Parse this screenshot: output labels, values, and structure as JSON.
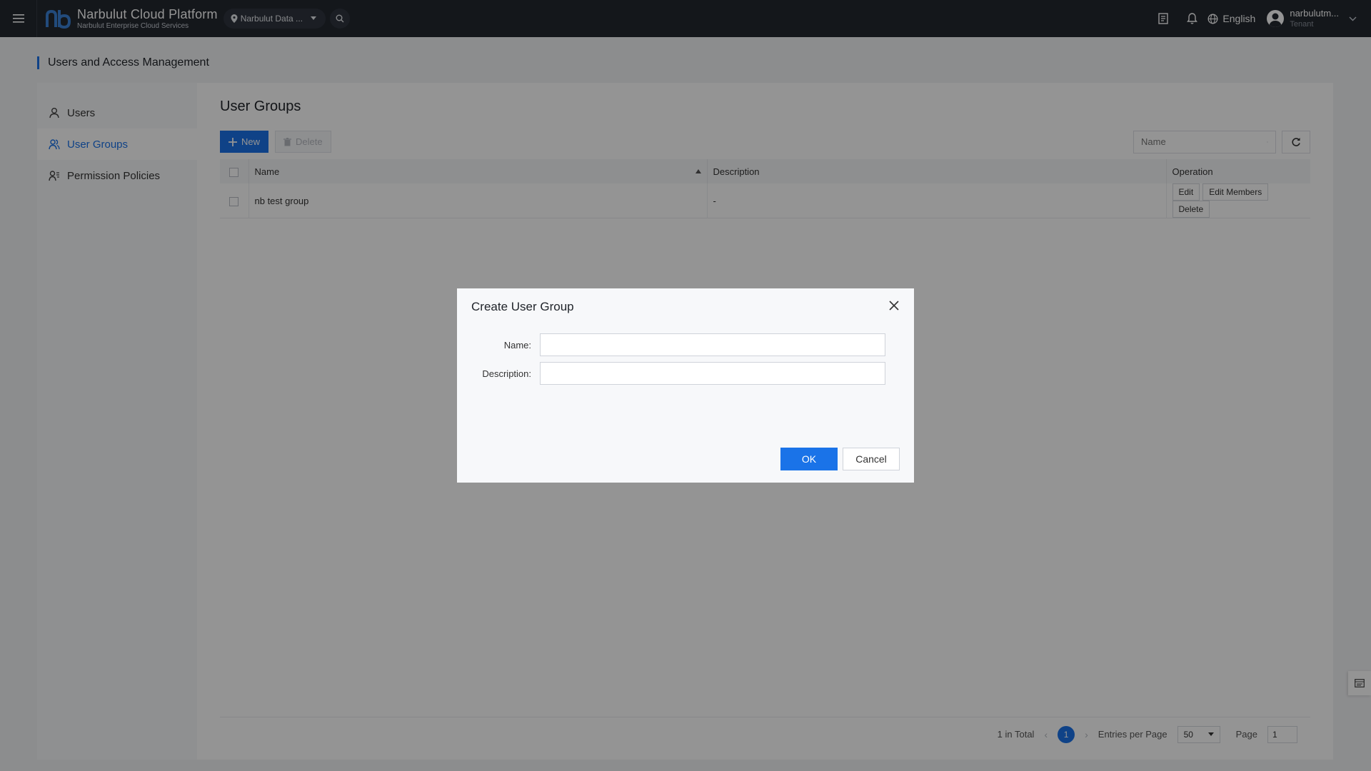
{
  "header": {
    "brand_title": "Narbulut Cloud Platform",
    "brand_subtitle": "Narbulut Enterprise Cloud Services",
    "region": "Narbulut Data ...",
    "language": "English",
    "user_name": "narbulutm...",
    "user_role": "Tenant",
    "icons": [
      "menu-icon",
      "location-pin-icon",
      "search-icon",
      "document-icon",
      "bell-icon",
      "globe-icon",
      "user-avatar-icon",
      "chevron-down-icon"
    ]
  },
  "page": {
    "title": "Users and Access Management"
  },
  "sidebar": {
    "items": [
      {
        "label": "Users",
        "icon": "user-icon",
        "active": false
      },
      {
        "label": "User Groups",
        "icon": "user-group-icon",
        "active": true
      },
      {
        "label": "Permission Policies",
        "icon": "permission-icon",
        "active": false
      }
    ]
  },
  "main": {
    "title": "User Groups",
    "new_label": "New",
    "delete_label": "Delete",
    "search_placeholder": "Name",
    "table": {
      "columns": [
        "Name",
        "Description",
        "Operation"
      ],
      "rows": [
        {
          "name": "nb test group",
          "description": "-",
          "actions": [
            "Edit",
            "Edit Members",
            "Delete"
          ]
        }
      ]
    },
    "pagination": {
      "total": "1 in Total",
      "current_page": "1",
      "entries_label": "Entries per Page",
      "entries_value": "50",
      "page_label": "Page",
      "page_value": "1"
    }
  },
  "modal": {
    "title": "Create User Group",
    "name_label": "Name:",
    "name_value": "",
    "description_label": "Description:",
    "description_value": "",
    "ok_label": "OK",
    "cancel_label": "Cancel"
  },
  "colors": {
    "accent": "#1a73e8",
    "topbar": "#232830"
  }
}
